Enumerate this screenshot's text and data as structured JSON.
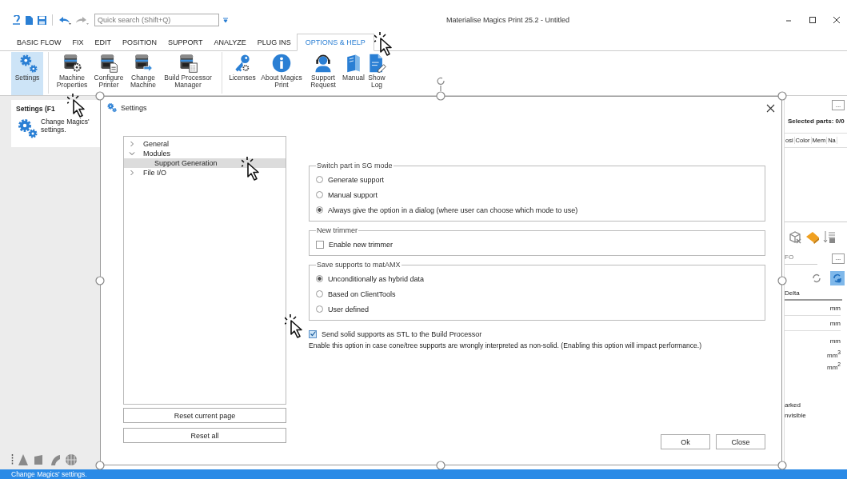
{
  "title_bar": {
    "quick_search": {
      "placeholder": "Quick search (Shift+Q)"
    },
    "title": "Materialise Magics Print 25.2 - Untitled"
  },
  "tabs": [
    {
      "label": "BASIC FLOW",
      "selected": false
    },
    {
      "label": "FIX",
      "selected": false
    },
    {
      "label": "EDIT",
      "selected": false
    },
    {
      "label": "POSITION",
      "selected": false
    },
    {
      "label": "SUPPORT",
      "selected": false
    },
    {
      "label": "ANALYZE",
      "selected": false
    },
    {
      "label": "PLUG INS",
      "selected": false
    },
    {
      "label": "OPTIONS & HELP",
      "selected": true
    }
  ],
  "ribbon": {
    "buttons": [
      {
        "label": "Settings",
        "kind": "gears",
        "selected": true
      },
      {
        "label": "Machine Properties",
        "kind": "printer-gear",
        "selected": false
      },
      {
        "label": "Configure Printer",
        "kind": "printer-doc",
        "selected": false
      },
      {
        "label": "Change Machine",
        "kind": "printer-swap",
        "selected": false
      },
      {
        "label": "Build Processor Manager",
        "kind": "printer-calc",
        "selected": false
      },
      {
        "label": "Licenses",
        "kind": "key",
        "selected": false
      },
      {
        "label": "About Magics Print",
        "kind": "info",
        "selected": false
      },
      {
        "label": "Support Request",
        "kind": "headset",
        "selected": false
      },
      {
        "label": "Manual",
        "kind": "book",
        "selected": false
      },
      {
        "label": "Show Log",
        "kind": "log",
        "selected": false
      }
    ]
  },
  "tooltip": {
    "title": "Settings (F1",
    "text": "Change Magics' settings."
  },
  "dialog": {
    "title": "Settings",
    "tree": [
      {
        "label": "General",
        "expanded": false,
        "selected": false
      },
      {
        "label": "Modules",
        "expanded": true,
        "selected": false,
        "children": [
          {
            "label": "Support Generation",
            "selected": true
          }
        ]
      },
      {
        "label": "File I/O",
        "expanded": false,
        "selected": false
      }
    ],
    "side_buttons": [
      "Reset current page",
      "Reset all"
    ],
    "groups": [
      {
        "legend": "Switch part in SG mode",
        "options": [
          {
            "kind": "radio",
            "label": "Generate support",
            "selected": false
          },
          {
            "kind": "radio",
            "label": "Manual support",
            "selected": false
          },
          {
            "kind": "radio",
            "label": "Always give the option in a dialog (where user can choose which mode to use)",
            "selected": true
          }
        ]
      },
      {
        "legend": "New trimmer",
        "options": [
          {
            "kind": "checkbox",
            "label": "Enable new trimmer",
            "checked": false
          }
        ]
      },
      {
        "legend": "Save supports to matAMX",
        "options": [
          {
            "kind": "radio",
            "label": "Unconditionally as hybrid data",
            "selected": true
          },
          {
            "kind": "radio",
            "label": "Based on ClientTools",
            "selected": false
          },
          {
            "kind": "radio",
            "label": "User defined",
            "selected": false
          }
        ]
      }
    ],
    "send_option": {
      "label": "Send solid supports as STL to the Build Processor",
      "checked": true
    },
    "note": "Enable this option in case cone/tree supports are wrongly interpreted as non-solid. (Enabling this option will impact performance.)",
    "buttons": [
      "Ok",
      "Close"
    ]
  },
  "right_panel": {
    "more_button": "...",
    "selected_parts": "Selected parts: 0/0",
    "columns": [
      "osi",
      "Color",
      "Mem",
      "Na"
    ],
    "info_label": "FO",
    "more_button_2": "...",
    "delta_header": "Delta",
    "units": [
      "mm",
      "mm",
      "mm",
      "mm$^{3}$",
      "mm$^{2}$"
    ],
    "flags": [
      "arked",
      "nvisible"
    ]
  },
  "status_bar": {
    "text": "Change Magics' settings."
  }
}
